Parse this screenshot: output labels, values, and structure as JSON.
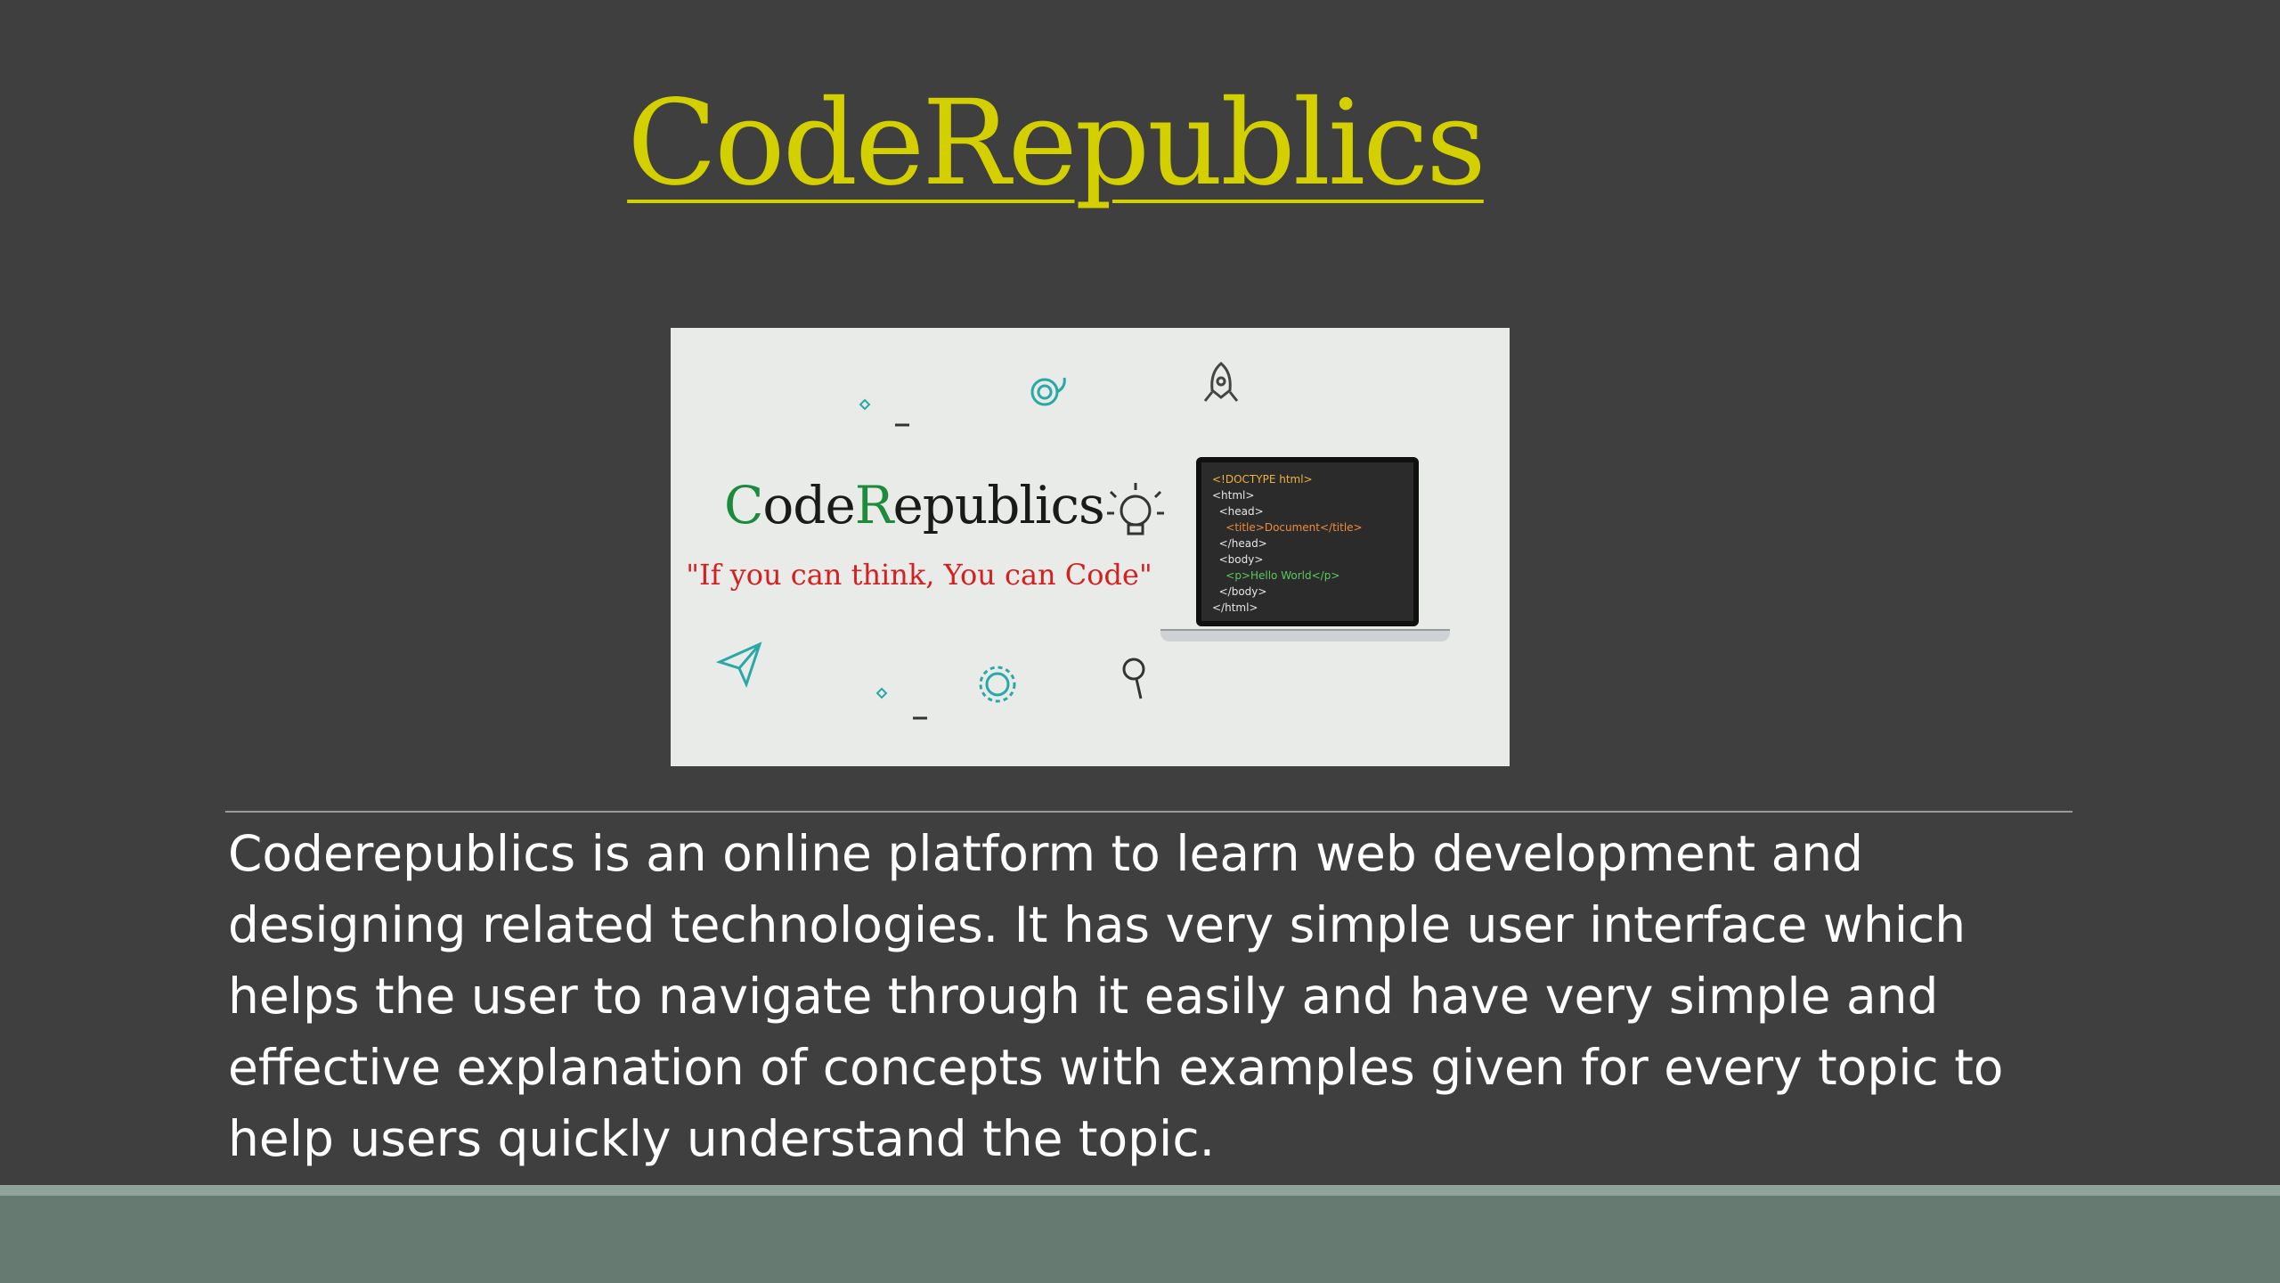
{
  "slide": {
    "title": "CodeRepublics",
    "description": "Coderepublics is an online platform to learn web development and designing related technologies. It has very simple user interface which helps the user to navigate through it easily and have very simple and effective explanation of concepts with examples given for every topic to help users quickly understand the topic."
  },
  "banner": {
    "brand_first": "C",
    "brand_mid": "ode",
    "brand_r": "R",
    "brand_rest": "epublics",
    "tagline": "\"If you can think, You can Code\"",
    "code_lines": [
      "<!DOCTYPE html>",
      "<html>",
      "  <head>",
      "    <title>Document</title>",
      "  </head>",
      "  <body>",
      "    <p>Hello World</p>",
      "  </body>",
      "</html>"
    ]
  },
  "colors": {
    "background": "#3f3f3f",
    "title": "#d4d000",
    "footer": "#667a71",
    "tagline": "#d32020",
    "brand_accent": "#1d8a3c"
  },
  "icons": [
    "lightbulb-icon",
    "rocket-icon",
    "paper-plane-icon",
    "gear-icon",
    "magnifier-icon",
    "swirl-icon"
  ]
}
